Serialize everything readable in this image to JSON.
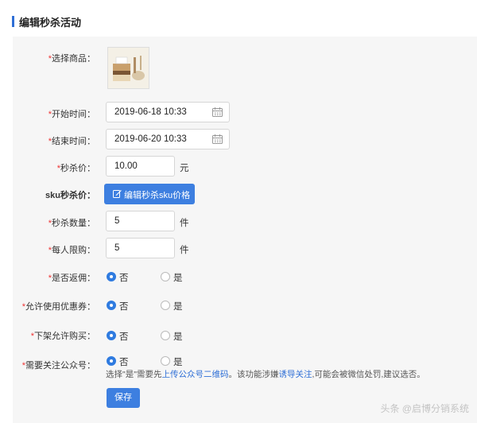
{
  "header": {
    "title": "编辑秒杀活动"
  },
  "form": {
    "product": {
      "required": "*",
      "label": "选择商品："
    },
    "start_time": {
      "required": "*",
      "label": "开始时间：",
      "value": "2019-06-18 10:33"
    },
    "end_time": {
      "required": "*",
      "label": "结束时间：",
      "value": "2019-06-20 10:33"
    },
    "price": {
      "required": "*",
      "label": "秒杀价：",
      "value": "10.00",
      "unit": "元"
    },
    "sku_price": {
      "label": "sku秒杀价：",
      "button": "编辑秒杀sku价格"
    },
    "quantity": {
      "required": "*",
      "label": "秒杀数量：",
      "value": "5",
      "unit": "件"
    },
    "limit": {
      "required": "*",
      "label": "每人限购：",
      "value": "5",
      "unit": "件"
    },
    "rebate": {
      "required": "*",
      "label": "是否返佣：",
      "options": [
        "否",
        "是"
      ],
      "selected": "否"
    },
    "coupon": {
      "required": "*",
      "label": "允许使用优惠券：",
      "options": [
        "否",
        "是"
      ],
      "selected": "否"
    },
    "offshelf": {
      "required": "*",
      "label": "下架允许购买：",
      "options": [
        "否",
        "是"
      ],
      "selected": "否"
    },
    "follow": {
      "required": "*",
      "label": "需要关注公众号：",
      "options": [
        "否",
        "是"
      ],
      "selected": "否"
    },
    "note": {
      "prefix": "选择\"是\"需要先",
      "link1": "上传公众号二维码",
      "middle": "。该功能涉嫌",
      "link2": "诱导关注",
      "suffix": ",可能会被微信处罚,建议选否。"
    },
    "save_label": "保存"
  },
  "watermark": "头条 @启博分销系统",
  "colors": {
    "accent": "#3d7fe0",
    "required": "#e33333",
    "panel": "#f6f6f6"
  },
  "icons": [
    "calendar-icon",
    "edit-icon",
    "product-thumbnail"
  ]
}
